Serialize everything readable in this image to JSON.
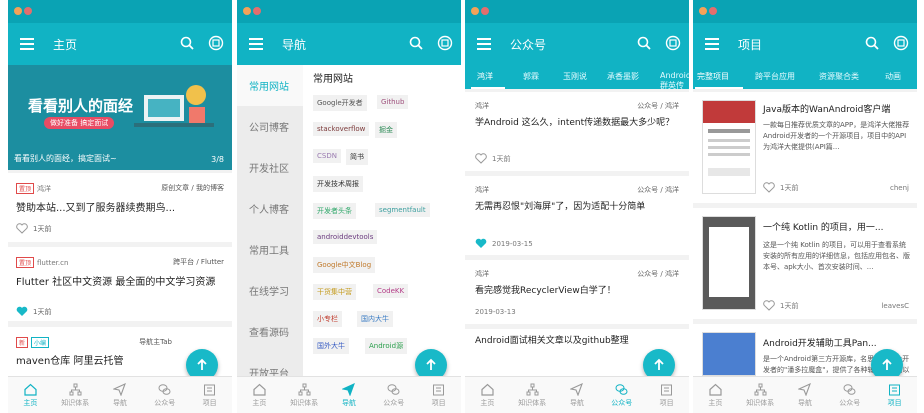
{
  "colors": {
    "primary": "#11b3c4",
    "statusbar": "#0aa3b4",
    "fab": "#18b9c8",
    "banner": "#1c8ea0"
  },
  "bottom_tabs": [
    "主页",
    "知识体系",
    "导航",
    "公众号",
    "项目"
  ],
  "screens": [
    {
      "title": "主页",
      "banner": {
        "headline": "看看别人的面经",
        "sub": "做好准备 搞定面试",
        "caption": "看看别人的面经，搞定面试~",
        "index": "3/8"
      },
      "articles": [
        {
          "tag": "置顶",
          "author": "鸿洋",
          "category": "原创文章 / 我的博客",
          "title": "赞助本站...又到了服务器续费期鸟...",
          "time": "1天前",
          "liked": false
        },
        {
          "tag": "置顶",
          "author": "flutter.cn",
          "category": "跨平台 / Flutter",
          "title": "Flutter 社区中文资源  最全面的中文学习资源",
          "time": "1天前",
          "liked": true
        },
        {
          "tag": "新",
          "tag2": "小编",
          "author": "小编",
          "category": "导航主Tab",
          "title": "maven仓库 阿里云托管",
          "time": "",
          "liked": false
        }
      ]
    },
    {
      "title": "导航",
      "nav_items": [
        "常用网站",
        "公司博客",
        "开发社区",
        "个人博客",
        "常用工具",
        "在线学习",
        "查看源码",
        "开放平台"
      ],
      "section_title": "常用网站",
      "chips": [
        {
          "text": "Google开发者",
          "color": "#555555"
        },
        {
          "text": "Github",
          "color": "#a0527e"
        },
        {
          "text": "stackoverflow",
          "color": "#7c3a3a"
        },
        {
          "text": "掘金",
          "color": "#2e8b57"
        },
        {
          "text": "CSDN",
          "color": "#9a7bb0"
        },
        {
          "text": "简书",
          "color": "#333333"
        },
        {
          "text": "开发技术周报",
          "color": "#333333"
        },
        {
          "text": "开发者头条",
          "color": "#2fa86a"
        },
        {
          "text": "segmentfault",
          "color": "#3c9f9f"
        },
        {
          "text": "androiddevtools",
          "color": "#6b3b7f"
        },
        {
          "text": "Google中文Blog",
          "color": "#c0792a"
        },
        {
          "text": "干货集中营",
          "color": "#c49a1b"
        },
        {
          "text": "CodeKK",
          "color": "#b43c87"
        },
        {
          "text": "小专栏",
          "color": "#c0392b"
        },
        {
          "text": "国内大牛",
          "color": "#3a7cc4"
        },
        {
          "text": "国外大牛",
          "color": "#3a5ec4"
        },
        {
          "text": "Android源",
          "color": "#2b9e4c"
        }
      ]
    },
    {
      "title": "公众号",
      "tabs": [
        "鸿洋",
        "郭霖",
        "玉刚说",
        "承香墨影",
        "Android群英传"
      ],
      "articles": [
        {
          "author": "鸿洋",
          "category": "公众号 / 鸿洋",
          "title": "学Android 这么久，intent传递数据最大多少呢？",
          "time": "1天前",
          "liked": false
        },
        {
          "author": "鸿洋",
          "category": "公众号 / 鸿洋",
          "title": "无需再忍恨\"刘海屏\"了，因为适配十分简单",
          "time": "2019-03-15",
          "liked": true
        },
        {
          "author": "鸿洋",
          "category": "公众号 / 鸿洋",
          "title": "看完感觉我RecyclerView白学了！",
          "time": "2019-03-13",
          "liked": false
        },
        {
          "author": "鸿洋",
          "category": "公众号 / 鸿洋",
          "title": "Android面试相关文章以及github整理",
          "time": "",
          "liked": false
        }
      ]
    },
    {
      "title": "项目",
      "tabs": [
        "完整项目",
        "跨平台应用",
        "资源聚合类",
        "动画"
      ],
      "projects": [
        {
          "title": "Java版本的WanAndroid客户端",
          "desc": "一款每日推荐优质文章的APP，是鸿洋大佬推荐Android开发者的一个开源项目，项目中的API为鸿洋大佬提供(API篇...",
          "time": "1天前",
          "author": "chenj"
        },
        {
          "title": "一个纯 Kotlin 的项目，用一...",
          "desc": "这是一个纯 Kotlin 的项目，可以用于查看系统安装的所有应用的详细信息，包括应用包名、版本号、apk大小、首次安装时间、...",
          "time": "1天前",
          "author": "leavesC"
        },
        {
          "title": "Android开发辅助工具Pan...",
          "desc": "是一个Android第三方开源库，名思义，作为开发者的\"潘多拉魔盒\"，提供了各种辅助工具用以对各种问题方便快速地进行...",
          "time": "",
          "author": ""
        }
      ]
    }
  ]
}
